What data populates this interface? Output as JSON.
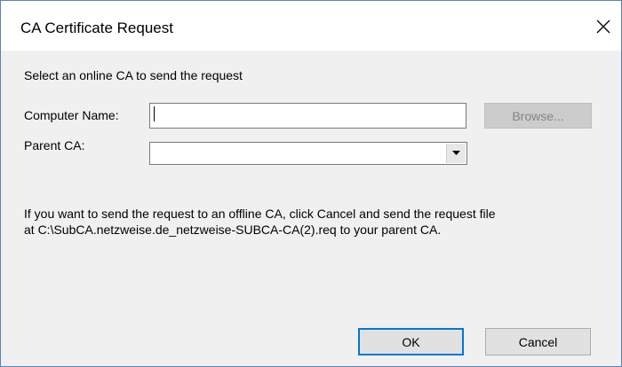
{
  "window": {
    "title": "CA Certificate Request"
  },
  "intro_text": "Select an online CA to send the request",
  "computer_name": {
    "label": "Computer Name:",
    "value": "",
    "browse_label": "Browse..."
  },
  "parent_ca": {
    "label": "Parent CA:",
    "value": ""
  },
  "info": {
    "line1": "If you want to send the request to an offline CA, click Cancel and send the request file",
    "line2": "at C:\\SubCA.netzweise.de_netzweise-SUBCA-CA(2).req to your parent CA."
  },
  "buttons": {
    "ok": "OK",
    "cancel": "Cancel"
  },
  "icons": {
    "close": "close-icon",
    "dropdown": "chevron-down-icon"
  }
}
